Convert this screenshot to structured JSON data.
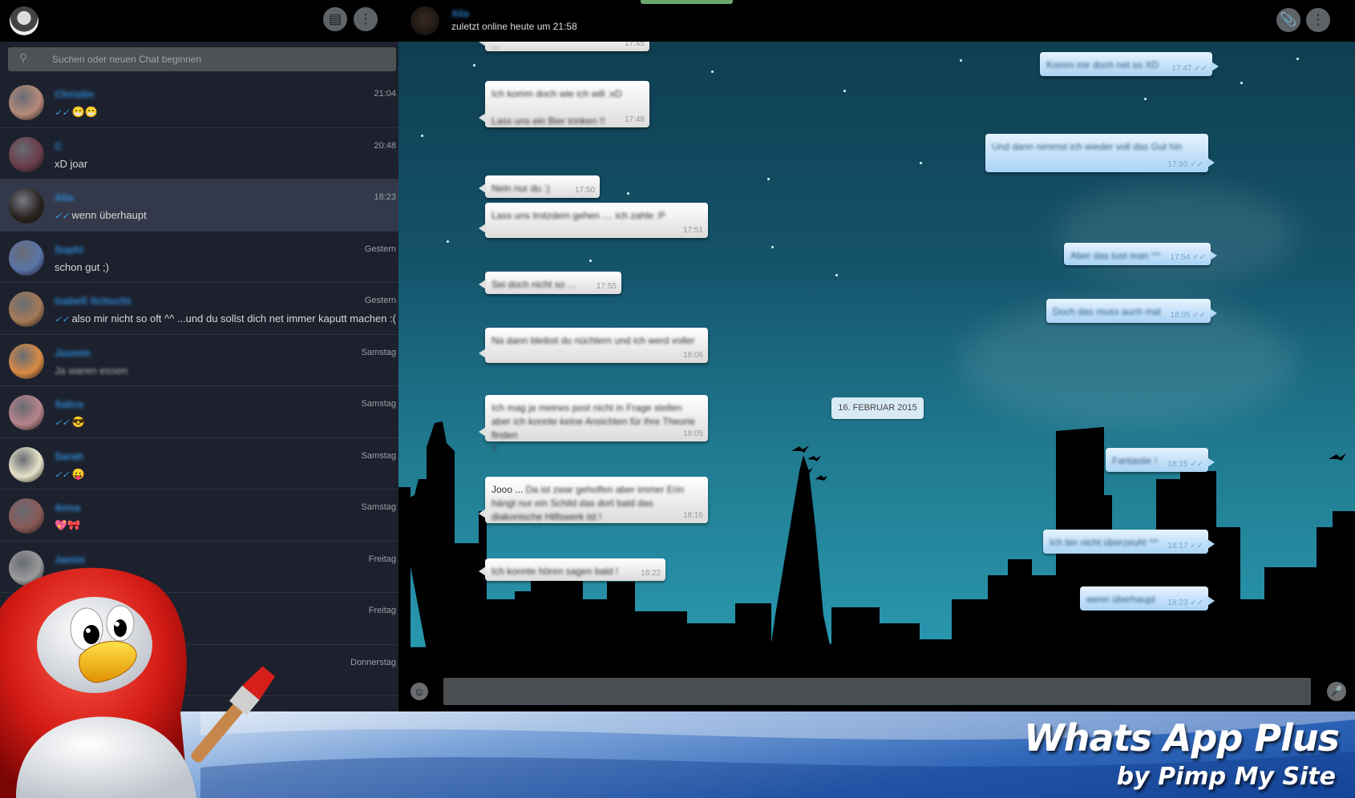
{
  "sidebar": {
    "search_placeholder": "Suchen oder neuen Chat beginnen",
    "chats": [
      {
        "name": "Christin",
        "time": "21:04",
        "last": "😁😁",
        "tick": true,
        "last_blurred": false,
        "avatar_color": "#b58a7a"
      },
      {
        "name": "C",
        "time": "20:48",
        "last": "xD joar",
        "tick": false,
        "last_blurred": false,
        "avatar_color": "#6a3e4a"
      },
      {
        "name": "Alia",
        "time": "18:23",
        "last": "wenn überhaupt",
        "tick": true,
        "last_blurred": false,
        "avatar_color": "#2b2420",
        "active": true
      },
      {
        "name": "Sophi",
        "time": "Gestern",
        "last": "schon gut ;)",
        "tick": false,
        "last_blurred": false,
        "avatar_color": "#5b74a8"
      },
      {
        "name": "Isabell Schucht",
        "time": "Gestern",
        "last": "also mir nicht so oft ^^ ...und du sollst dich net immer kaputt machen :(",
        "tick": true,
        "last_blurred": false,
        "avatar_color": "#a57a58"
      },
      {
        "name": "Jasmin",
        "time": "Samstag",
        "last": "Ja waren essen",
        "tick": false,
        "last_blurred": true,
        "avatar_color": "#d88b45"
      },
      {
        "name": "Sabra",
        "time": "Samstag",
        "last": "😎",
        "tick": true,
        "last_blurred": false,
        "avatar_color": "#b8838a"
      },
      {
        "name": "Sarah",
        "time": "Samstag",
        "last": "😛",
        "tick": true,
        "last_blurred": false,
        "avatar_color": "#e6e3c8"
      },
      {
        "name": "Anna",
        "time": "Samstag",
        "last": "💖🎀",
        "tick": false,
        "last_blurred": false,
        "avatar_color": "#8a5a58"
      },
      {
        "name": "Janini",
        "time": "Freitag",
        "last": "😊",
        "tick": false,
        "last_blurred": false,
        "avatar_color": "#9a9a9a"
      },
      {
        "name": "",
        "time": "Freitag",
        "last": "",
        "tick": false,
        "last_blurred": false,
        "avatar_color": "#556b3a"
      },
      {
        "name": "",
        "time": "Donnerstag",
        "last": "",
        "tick": false,
        "last_blurred": false,
        "avatar_color": "#444"
      }
    ]
  },
  "header": {
    "contact_name": "Alia",
    "contact_status": "zuletzt online heute um 21:58"
  },
  "chat": {
    "date_chip": "16. FEBRUAR 2015",
    "messages": [
      {
        "dir": "in",
        "prefix": "",
        "text": "...",
        "time": "17:45"
      },
      {
        "dir": "out",
        "prefix": "",
        "text": "Komm mir doch net so XD",
        "time": "17:47"
      },
      {
        "dir": "in",
        "prefix": "",
        "text": "Ich komm doch wie ich will :xD\n\nLass uns ein Bier trinken !!",
        "time": "17:48"
      },
      {
        "dir": "out",
        "prefix": "",
        "text": "Und dann nimmst ich wieder voll das Gut hin",
        "time": "17:50"
      },
      {
        "dir": "in",
        "prefix": "",
        "text": "Nein nur du :)",
        "time": "17:50"
      },
      {
        "dir": "in",
        "prefix": "",
        "text": "Lass uns trotzdem gehen .... ich zahle :P",
        "time": "17:51"
      },
      {
        "dir": "out",
        "prefix": "",
        "text": "Aber das tust man ^^",
        "time": "17:54"
      },
      {
        "dir": "in",
        "prefix": "",
        "text": "Sei doch nicht so ...",
        "time": "17:55"
      },
      {
        "dir": "out",
        "prefix": "",
        "text": "Doch das muss auch mal",
        "time": "18:05"
      },
      {
        "dir": "in",
        "prefix": "",
        "text": "Na dann bleibst du nüchtern und ich werd voller",
        "time": "18:06"
      },
      {
        "dir": "in",
        "prefix": "",
        "text": "Ich mag ja meines post nicht in Frage stellen aber ich konnte keine Ansichten für ihre Theorie finden\n!!",
        "time": "18:05"
      },
      {
        "dir": "out",
        "prefix": "",
        "text": "Fantastie !",
        "time": "18:15"
      },
      {
        "dir": "in",
        "prefix": "Jooo ... ",
        "text": "Da ist zwar geholfen aber immer Erin hängt nur ein Schild das dort bald das diakonische Hilfswerk ist !",
        "time": "18:16"
      },
      {
        "dir": "out",
        "prefix": "",
        "text": "Ich bin nicht überzeuht ^^",
        "time": "18:17"
      },
      {
        "dir": "in",
        "prefix": "",
        "text": "Ich konnte hören sagen bald !",
        "time": "18:22"
      },
      {
        "dir": "out",
        "prefix": "",
        "text": "wenn überhaupt",
        "time": "18:23"
      }
    ]
  },
  "composer": {
    "placeholder": ""
  },
  "banner": {
    "title": "Whats App Plus",
    "subtitle": "by Pimp My Site"
  },
  "icons": {
    "new_chat": "chat-bubble-icon",
    "menu": "vertical-dots-icon",
    "attach": "paperclip-icon",
    "search": "search-icon",
    "emoji": "emoji-icon",
    "mic": "microphone-icon"
  },
  "colors": {
    "accent_name": "#2e8bd8",
    "tick": "#3ea7f0",
    "sidebar_bg": "#1c212d",
    "active_row": "#33394a"
  }
}
